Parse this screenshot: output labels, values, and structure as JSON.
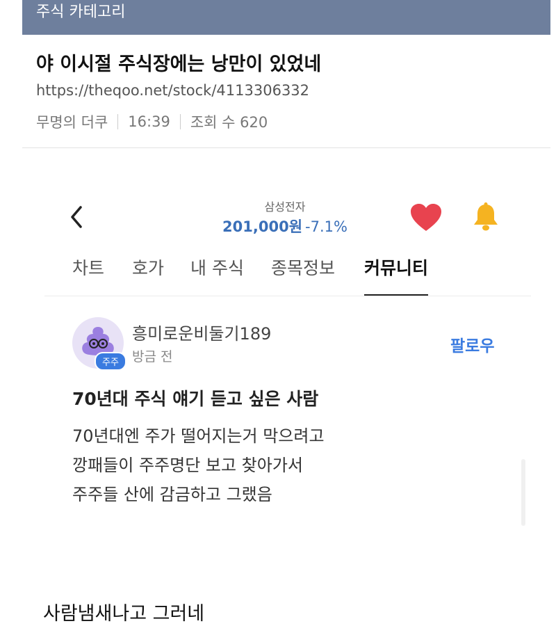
{
  "category": {
    "label": "주식 카테고리"
  },
  "post": {
    "title": "야 이시절 주식장에는 낭만이 있었네",
    "url": "https://theqoo.net/stock/4113306332",
    "author": "무명의 더쿠",
    "time": "16:39",
    "views": "조회 수 620"
  },
  "app": {
    "stock_name": "삼성전자",
    "price": "201,000원",
    "change": "-7.1%",
    "tabs": [
      {
        "label": "차트"
      },
      {
        "label": "호가"
      },
      {
        "label": "내 주식"
      },
      {
        "label": "종목정보"
      },
      {
        "label": "커뮤니티"
      }
    ],
    "active_tab": "커뮤니티",
    "community_post": {
      "author": "흥미로운비둘기189",
      "time": "방금 전",
      "badge": "주주",
      "follow_label": "팔로우",
      "title": "70년대 주식 얘기 듣고 싶은 사람",
      "body_lines": [
        "70년대엔 주가 떨어지는거 막으려고",
        "깡패들이 주주명단 보고 찾아가서",
        "주주들 산에 감금하고 그랬음"
      ]
    },
    "colors": {
      "price": "#3a6fb8",
      "heart": "#e8434f",
      "bell": "#f5b321",
      "follow": "#3a7be0"
    }
  },
  "comment": {
    "text": "사람냄새나고 그러네"
  }
}
